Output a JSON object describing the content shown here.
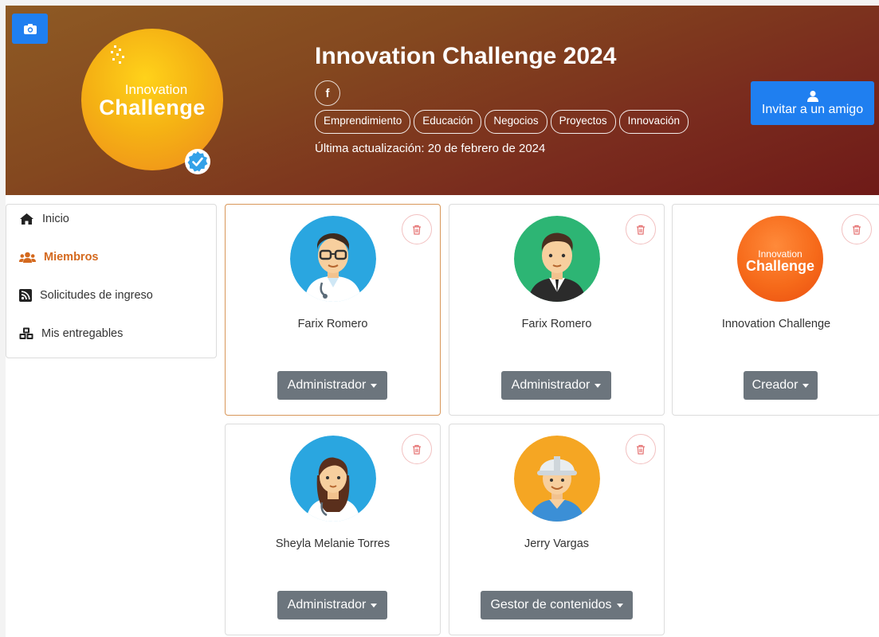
{
  "header": {
    "title": "Innovation Challenge 2024",
    "logo_line1": "Innovation",
    "logo_line2": "Challenge",
    "facebook_label": "f",
    "tags": [
      "Emprendimiento",
      "Educación",
      "Negocios",
      "Proyectos",
      "Innovación"
    ],
    "updated": "Última actualización: 20 de febrero de 2024",
    "invite_label": "Invitar a un amigo"
  },
  "sidebar": {
    "items": [
      {
        "label": "Inicio",
        "icon": "home-icon"
      },
      {
        "label": "Miembros",
        "icon": "users-icon",
        "active": true
      },
      {
        "label": "Solicitudes de ingreso",
        "icon": "rss-icon"
      },
      {
        "label": "Mis entregables",
        "icon": "cubes-icon"
      }
    ]
  },
  "members": [
    {
      "name": "Farix Romero",
      "role": "Administrador",
      "avatar": "man-glasses-avatar"
    },
    {
      "name": "Farix Romero",
      "role": "Administrador",
      "avatar": "man-suit-avatar"
    },
    {
      "name": "Innovation Challenge",
      "role": "Creador",
      "avatar": "innovation-challenge-logo",
      "logo_line1": "Innovation",
      "logo_line2": "Challenge"
    },
    {
      "name": "Sheyla Melanie Torres",
      "role": "Administrador",
      "avatar": "woman-doctor-avatar"
    },
    {
      "name": "Jerry Vargas",
      "role": "Gestor de contenidos",
      "avatar": "worker-helmet-avatar"
    }
  ],
  "colors": {
    "primary": "#1f7ff0",
    "active_nav": "#d4691e",
    "role_button": "#6c757d",
    "trash": "#e57373"
  }
}
